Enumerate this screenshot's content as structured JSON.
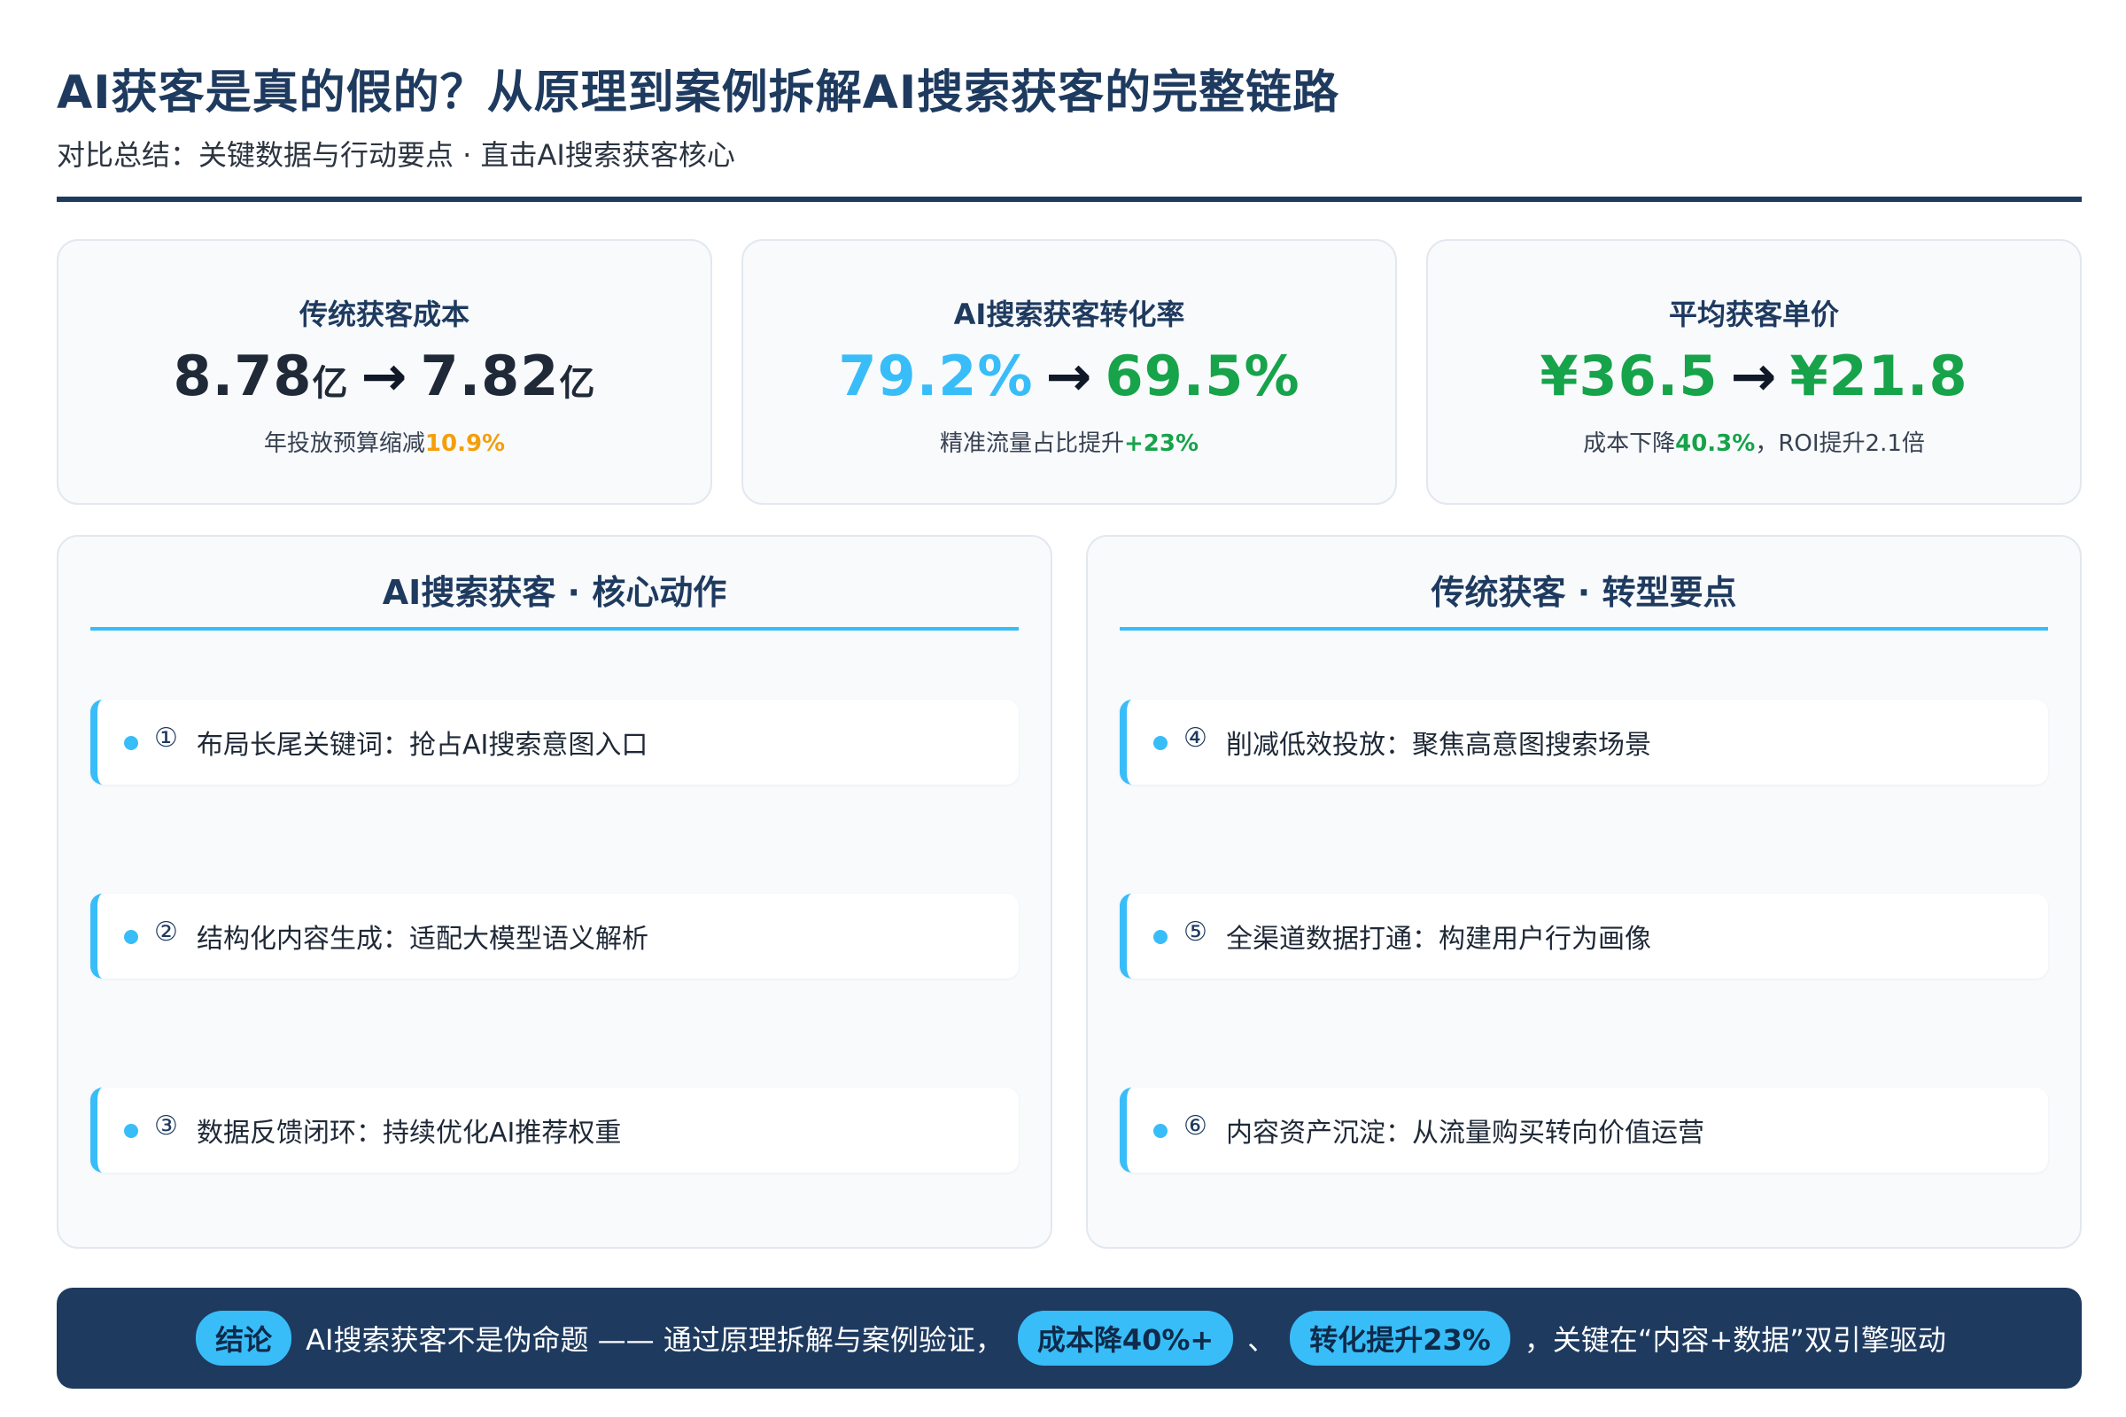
{
  "header": {
    "title": "AI获客是真的假的？从原理到案例拆解AI搜索获客的完整链路",
    "subtitle": "对比总结：关键数据与行动要点 · 直击AI搜索获客核心"
  },
  "stats": [
    {
      "label": "传统获客成本",
      "from": "8.78",
      "from_unit": "亿",
      "arrow": "→",
      "to": "7.82",
      "to_unit": "亿",
      "note_prefix": "年投放预算缩减",
      "note_highlight": "10.9%",
      "note_suffix": ""
    },
    {
      "label": "AI搜索获客转化率",
      "from": "79.2%",
      "from_unit": "",
      "arrow": "→",
      "to": "69.5%",
      "to_unit": "",
      "note_prefix": "精准流量占比提升",
      "note_highlight": "+23%",
      "note_suffix": ""
    },
    {
      "label": "平均获客单价",
      "from": "¥36.5",
      "from_unit": "",
      "arrow": "→",
      "to": "¥21.8",
      "to_unit": "",
      "note_prefix": "成本下降",
      "note_highlight": "40.3%",
      "note_suffix": "，ROI提升2.1倍"
    }
  ],
  "panels": [
    {
      "title": "AI搜索获客 · 核心动作",
      "items": [
        {
          "num": "①",
          "text": "布局长尾关键词：抢占AI搜索意图入口"
        },
        {
          "num": "②",
          "text": "结构化内容生成：适配大模型语义解析"
        },
        {
          "num": "③",
          "text": "数据反馈闭环：持续优化AI推荐权重"
        }
      ]
    },
    {
      "title": "传统获客 · 转型要点",
      "items": [
        {
          "num": "④",
          "text": "削减低效投放：聚焦高意图搜索场景"
        },
        {
          "num": "⑤",
          "text": "全渠道数据打通：构建用户行为画像"
        },
        {
          "num": "⑥",
          "text": "内容资产沉淀：从流量购买转向价值运营"
        }
      ]
    }
  ],
  "conclusion": {
    "tag": "结论",
    "text1": "AI搜索获客不是伪命题 —— 通过原理拆解与案例验证，",
    "pill1": "成本降40%+",
    "sep": "、",
    "pill2": "转化提升23%",
    "text2": "，关键在“内容+数据”双引擎驱动"
  },
  "colors": {
    "navy": "#1e3a5f",
    "accent_blue": "#38bdf8",
    "green": "#16a34a",
    "orange": "#f59e0b"
  }
}
